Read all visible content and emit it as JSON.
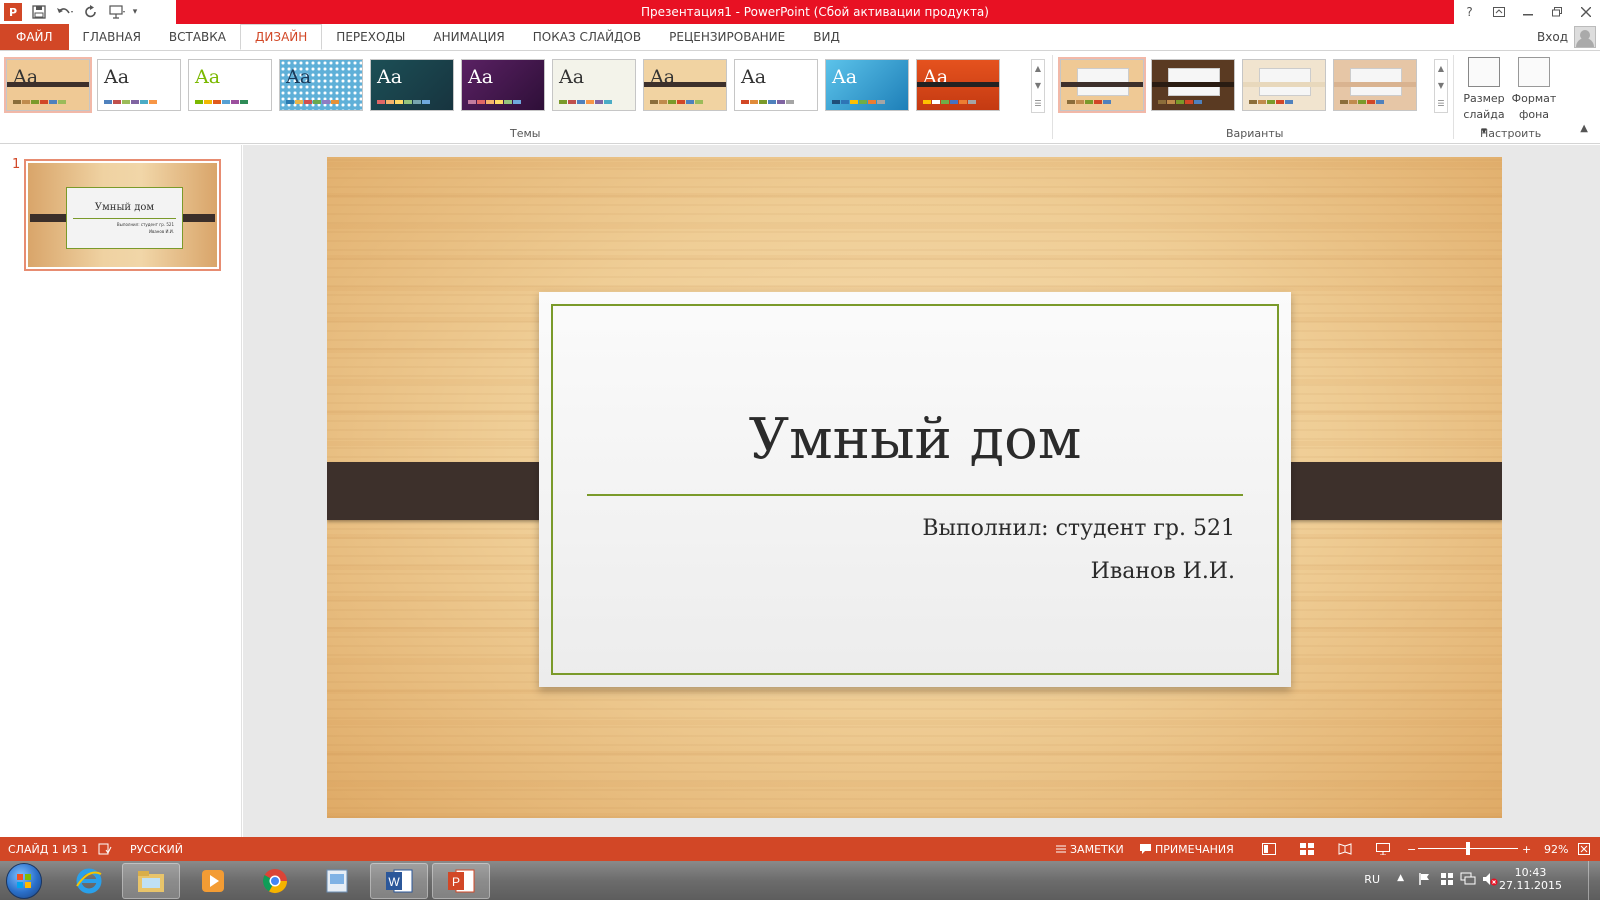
{
  "window": {
    "title": "Презентация1 -  PowerPoint (Сбой активации продукта)",
    "help": "?",
    "login": "Вход"
  },
  "tabs": [
    {
      "label": "ФАЙЛ"
    },
    {
      "label": "ГЛАВНАЯ"
    },
    {
      "label": "ВСТАВКА"
    },
    {
      "label": "ДИЗАЙН"
    },
    {
      "label": "ПЕРЕХОДЫ"
    },
    {
      "label": "АНИМАЦИЯ"
    },
    {
      "label": "ПОКАЗ СЛАЙДОВ"
    },
    {
      "label": "РЕЦЕНЗИРОВАНИЕ"
    },
    {
      "label": "ВИД"
    }
  ],
  "ribbon": {
    "themes_label": "Темы",
    "variants_label": "Варианты",
    "customize_label": "Настроить",
    "slide_size_line1": "Размер",
    "slide_size_line2": "слайда",
    "bg_format_line1": "Формат",
    "bg_format_line2": "фона",
    "theme_sample": "Aa"
  },
  "themes": [
    {
      "bg": "#efc995",
      "text": "#333333",
      "bar": "#3d302b",
      "colors": [
        "#8b6d3a",
        "#c08b4d",
        "#7a9a2a",
        "#d24726",
        "#4f81bd",
        "#9bbb59"
      ]
    },
    {
      "bg": "#ffffff",
      "text": "#333333",
      "bar": "",
      "colors": [
        "#4f81bd",
        "#c0504d",
        "#9bbb59",
        "#8064a2",
        "#4bacc6",
        "#f79646"
      ]
    },
    {
      "bg": "#ffffff",
      "text": "#7ab800",
      "bar": "",
      "colors": [
        "#7ab800",
        "#f2b800",
        "#e05a1e",
        "#56a0d3",
        "#9c4f9e",
        "#2e8b57"
      ]
    },
    {
      "bg": "#5fb0d8",
      "text": "#1a3a5a",
      "bar": "",
      "colors": [
        "#2a7ab0",
        "#e8b64c",
        "#d04f4f",
        "#6aa84f",
        "#8e7cc3",
        "#e69138"
      ]
    },
    {
      "bg": "#1f4b57",
      "text": "#ffffff",
      "bar": "",
      "colors": [
        "#e06666",
        "#f6b26b",
        "#ffd966",
        "#93c47d",
        "#76a5af",
        "#6fa8dc"
      ]
    },
    {
      "bg": "#4a1a5a",
      "text": "#ffffff",
      "bar": "",
      "colors": [
        "#c27ba0",
        "#e06666",
        "#f6b26b",
        "#ffd966",
        "#93c47d",
        "#6fa8dc"
      ]
    },
    {
      "bg": "#f3f3ea",
      "text": "#333333",
      "bar": "",
      "colors": [
        "#7a9a2a",
        "#c0504d",
        "#4f81bd",
        "#f79646",
        "#8064a2",
        "#4bacc6"
      ]
    },
    {
      "bg": "#f1d3a2",
      "text": "#333333",
      "bar": "#3d302b",
      "colors": [
        "#8b6d3a",
        "#c08b4d",
        "#7a9a2a",
        "#d24726",
        "#4f81bd",
        "#9bbb59"
      ]
    },
    {
      "bg": "#ffffff",
      "text": "#333333",
      "bar": "",
      "colors": [
        "#d24726",
        "#e08b3a",
        "#7a9a2a",
        "#4f81bd",
        "#8064a2",
        "#a5a5a5"
      ]
    },
    {
      "bg": "#3aa3d5",
      "text": "#ffffff",
      "bar": "",
      "colors": [
        "#1f4e79",
        "#2e75b6",
        "#ffc000",
        "#70ad47",
        "#ed7d31",
        "#a5a5a5"
      ]
    },
    {
      "bg": "#d9461c",
      "text": "#ffffff",
      "bar": "#222222",
      "colors": [
        "#ffc000",
        "#ffffff",
        "#70ad47",
        "#4472c4",
        "#ed7d31",
        "#a5a5a5"
      ]
    }
  ],
  "variants": [
    {
      "bg": "#efc995",
      "bar": "#3d302b"
    },
    {
      "bg": "#5a3a22",
      "bar": "#2a1c12"
    },
    {
      "bg": "#f1e4cf",
      "bar": "#e8d8bc"
    },
    {
      "bg": "#e6c6a6",
      "bar": "#d9b390"
    }
  ],
  "thumbnail": {
    "number": "1",
    "title": "Умный дом",
    "sub1": "Выполнил: студент гр. 521",
    "sub2": "Иванов И.И."
  },
  "slide": {
    "title": "Умный дом",
    "subtitle_line1": "Выполнил: студент гр. 521",
    "subtitle_line2": "Иванов И.И.",
    "accent": "#7a9a2a"
  },
  "status": {
    "slide_counter": "СЛАЙД 1 ИЗ 1",
    "language": "РУССКИЙ",
    "notes": "ЗАМЕТКИ",
    "comments": "ПРИМЕЧАНИЯ",
    "zoom": "92%",
    "zoom_fraction": 0.5,
    "minus": "−",
    "plus": "+"
  },
  "taskbar": {
    "lang": "RU",
    "time": "10:43",
    "date": "27.11.2015"
  },
  "colors": {
    "accent": "#d24726",
    "title_red": "#e81123"
  }
}
